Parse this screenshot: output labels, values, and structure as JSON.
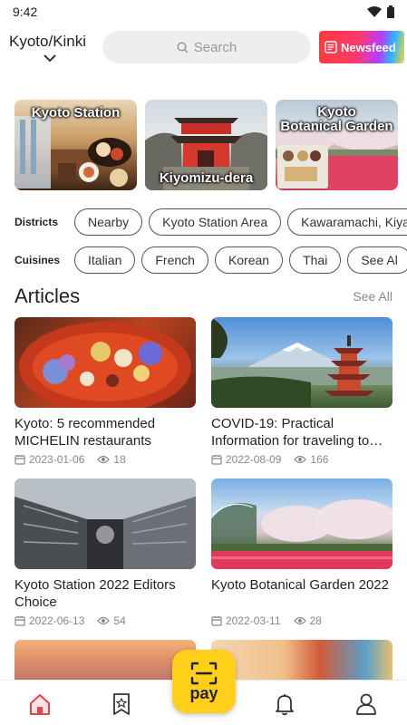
{
  "status_bar": {
    "time": "9:42"
  },
  "header": {
    "region": "Kyoto/Kinki",
    "search_placeholder": "Search",
    "newsfeed_label": "Newsfeed"
  },
  "banners": [
    {
      "title": "Kyoto Station"
    },
    {
      "title": "Kiyomizu-dera"
    },
    {
      "title_line1": "Kyoto",
      "title_line2": "Botanical Garden"
    }
  ],
  "districts": {
    "label": "Districts",
    "chips": [
      "Nearby",
      "Kyoto Station Area",
      "Kawaramachi, Kiya"
    ]
  },
  "cuisines": {
    "label": "Cuisines",
    "chips": [
      "Italian",
      "French",
      "Korean",
      "Thai",
      "See Al"
    ]
  },
  "articles": {
    "title": "Articles",
    "see_all": "See All",
    "items": [
      {
        "title": "Kyoto: 5 recommended MICHELIN restaurants",
        "date": "2023-01-06",
        "views": "18"
      },
      {
        "title": "COVID-19: Practical Information for traveling to…",
        "date": "2022-08-09",
        "views": "166"
      },
      {
        "title": "Kyoto Station 2022 Editors Choice",
        "date": "2022-06-13",
        "views": "54"
      },
      {
        "title": "Kyoto Botanical Garden 2022",
        "date": "2022-03-11",
        "views": "28"
      }
    ]
  },
  "bottom_nav": {
    "pay_label": "pay",
    "items": [
      "home-icon",
      "bookmark-star-icon",
      "bell-icon",
      "user-icon"
    ],
    "active_color": "#e8424f"
  }
}
